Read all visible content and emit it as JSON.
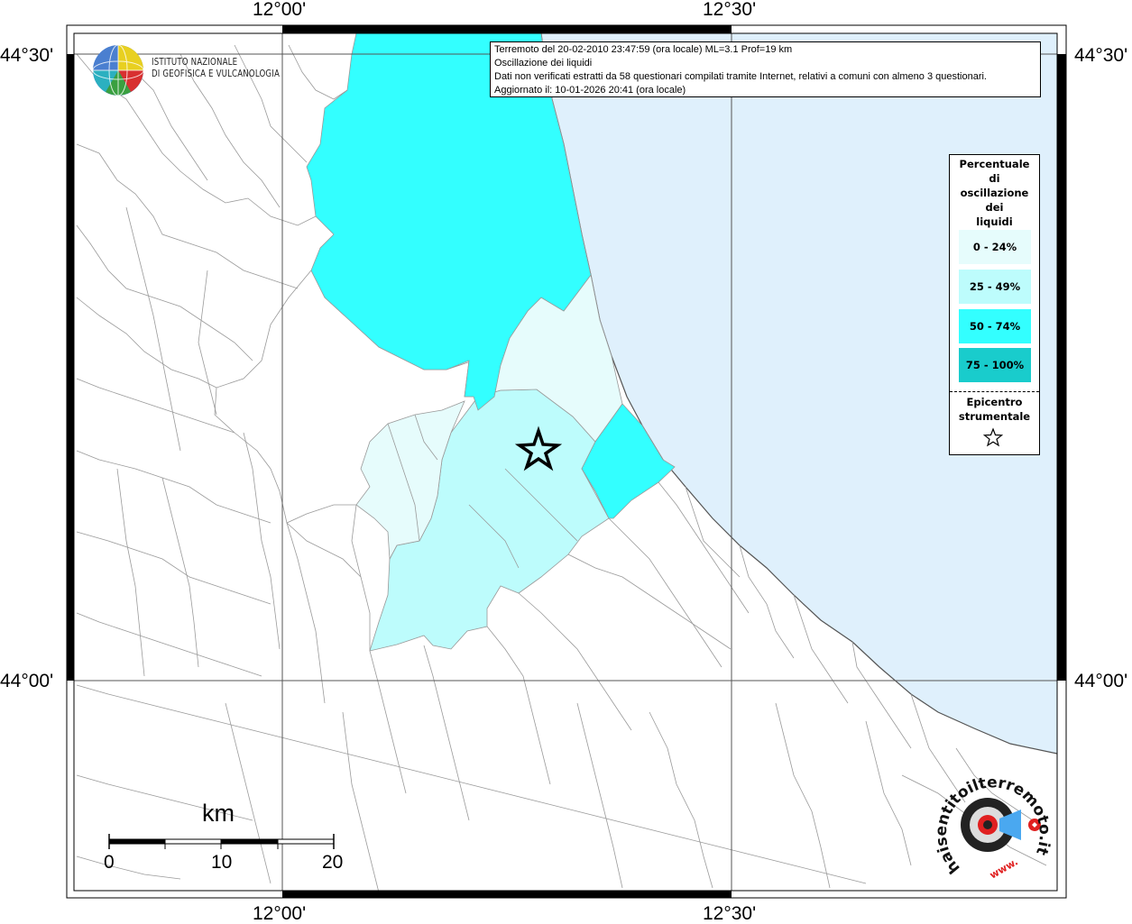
{
  "header": {
    "line1": "Terremoto del 20-02-2010 23:47:59 (ora locale) ML=3.1 Prof=19 km",
    "line2": "Oscillazione dei liquidi",
    "line3": "Dati non verificati estratti da 58 questionari compilati tramite Internet, relativi a comuni con almeno 3 questionari.",
    "line4": "Aggiornato il: 10-01-2026 20:41 (ora locale)"
  },
  "institute": {
    "line1": "ISTITUTO NAZIONALE",
    "line2": "DI GEOFISICA E VULCANOLOGIA"
  },
  "axes": {
    "lon_left": "12°00'",
    "lon_right": "12°30'",
    "lat_top": "44°30'",
    "lat_bottom": "44°00'"
  },
  "legend": {
    "title_lines": [
      "Percentuale",
      "di",
      "oscillazione",
      "dei",
      "liquidi"
    ],
    "classes": [
      {
        "label": "0 - 24%",
        "color": "#e6fcfc"
      },
      {
        "label": "25 - 49%",
        "color": "#bdfcfc"
      },
      {
        "label": "50 - 74%",
        "color": "#33ffff"
      },
      {
        "label": "75 - 100%",
        "color": "#19cccc"
      }
    ],
    "epicenter_lines": [
      "Epicentro",
      "strumentale"
    ]
  },
  "scale_bar": {
    "unit": "km",
    "ticks": [
      "0",
      "10",
      "20"
    ]
  },
  "watermark": {
    "text": "haisentitoilterremoto.it",
    "prefix": "www."
  },
  "colors": {
    "sea": "#dff0fc",
    "border": "#999999",
    "class_0_24": "#e6fcfc",
    "class_25_49": "#bdfcfc",
    "class_50_74": "#33ffff"
  }
}
